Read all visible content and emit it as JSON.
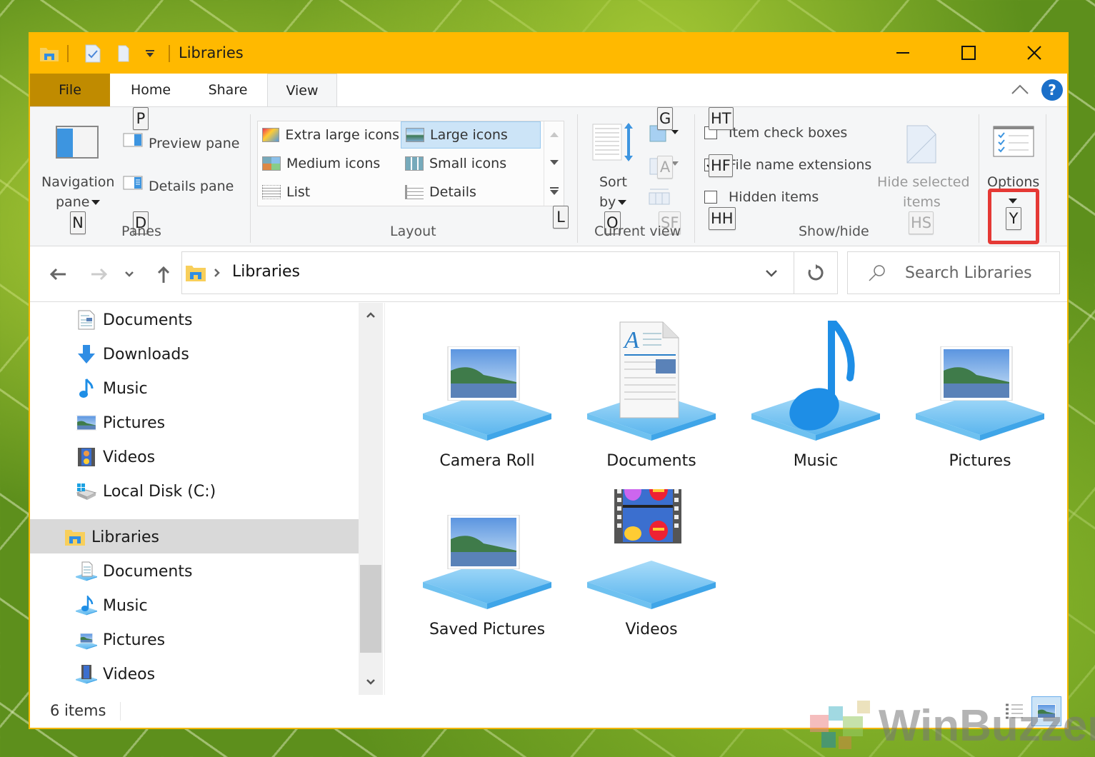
{
  "window": {
    "title": "Libraries",
    "accent": "#ffb900",
    "controls": {
      "minimize": "minimize-icon",
      "maximize": "maximize-icon",
      "close": "close-icon"
    }
  },
  "quick_access": {
    "items": [
      "explorer-libraries-icon",
      "properties-icon",
      "new-folder-icon",
      "customize-dropdown-icon"
    ]
  },
  "tabs": [
    {
      "label": "File",
      "key": ""
    },
    {
      "label": "Home",
      "key": ""
    },
    {
      "label": "Share",
      "key": ""
    },
    {
      "label": "View",
      "key": "",
      "active": true
    }
  ],
  "ribbon": {
    "panes": {
      "group_label": "Panes",
      "navigation_pane": {
        "line1": "Navigation",
        "line2": "pane",
        "key": "N"
      },
      "preview_pane": {
        "label": "Preview pane",
        "key": "P"
      },
      "details_pane": {
        "label": "Details pane",
        "key": "D"
      }
    },
    "layout": {
      "group_label": "Layout",
      "key": "L",
      "items": [
        {
          "label": "Extra large icons",
          "selected": false
        },
        {
          "label": "Large icons",
          "selected": true
        },
        {
          "label": "Medium icons",
          "selected": false
        },
        {
          "label": "Small icons",
          "selected": false
        },
        {
          "label": "List",
          "selected": false
        },
        {
          "label": "Details",
          "selected": false
        }
      ]
    },
    "current_view": {
      "group_label": "Current view",
      "sort_by": {
        "line1": "Sort",
        "line2": "by",
        "key": "O"
      },
      "group_by_key": "G",
      "add_columns_key": "A",
      "size_columns_key": "SF"
    },
    "show_hide": {
      "group_label": "Show/hide",
      "item_check_boxes": {
        "label": "Item check boxes",
        "key": "HT",
        "checked": false
      },
      "file_name_extensions": {
        "label": "File name extensions",
        "key": "HF",
        "checked": true
      },
      "hidden_items": {
        "label": "Hidden items",
        "key": "HH",
        "checked": false
      },
      "hide_selected": {
        "line1": "Hide selected",
        "line2": "items",
        "key": "HS"
      }
    },
    "options": {
      "label": "Options",
      "key": "Y"
    },
    "help_label": "?"
  },
  "address": {
    "path": [
      "Libraries"
    ],
    "search_placeholder": "Search Libraries"
  },
  "nav_pane": {
    "items": [
      {
        "label": "Documents",
        "icon": "documents-icon"
      },
      {
        "label": "Downloads",
        "icon": "downloads-icon"
      },
      {
        "label": "Music",
        "icon": "music-icon"
      },
      {
        "label": "Pictures",
        "icon": "pictures-icon"
      },
      {
        "label": "Videos",
        "icon": "videos-icon"
      },
      {
        "label": "Local Disk (C:)",
        "icon": "local-disk-icon"
      },
      {
        "label": "Libraries",
        "icon": "libraries-icon",
        "selected": true
      },
      {
        "label": "Documents",
        "icon": "documents-library-icon"
      },
      {
        "label": "Music",
        "icon": "music-library-icon"
      },
      {
        "label": "Pictures",
        "icon": "pictures-library-icon"
      },
      {
        "label": "Videos",
        "icon": "videos-library-icon"
      }
    ]
  },
  "content": {
    "items": [
      {
        "label": "Camera Roll",
        "icon": "camera-roll-library-icon"
      },
      {
        "label": "Documents",
        "icon": "documents-library-icon"
      },
      {
        "label": "Music",
        "icon": "music-library-icon"
      },
      {
        "label": "Pictures",
        "icon": "pictures-library-icon"
      },
      {
        "label": "Saved Pictures",
        "icon": "saved-pictures-library-icon"
      },
      {
        "label": "Videos",
        "icon": "videos-library-icon"
      }
    ]
  },
  "status": {
    "item_count": "6 items"
  },
  "watermark": "WinBuzzer"
}
